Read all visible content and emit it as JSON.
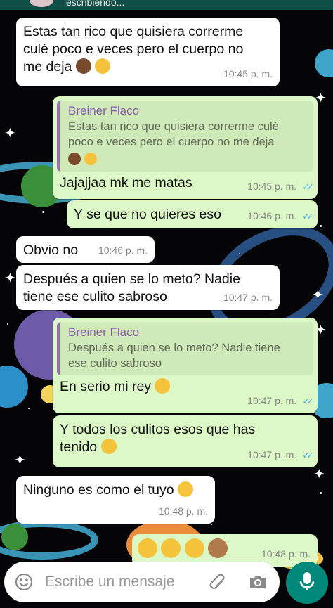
{
  "header": {
    "status": "escribiendo..."
  },
  "messages": [
    {
      "dir": "in",
      "text1": "Estas tan rico que quisiera correrme",
      "text2": "culé poco e veces pero el cuerpo no",
      "text3": "me deja",
      "time": "10:45 p. m."
    },
    {
      "dir": "out",
      "quote_author": "Breiner Flaco",
      "quote_line1": "Estas tan rico que quisiera correrme culé",
      "quote_line2": "poco e veces pero el cuerpo no me deja",
      "text": "Jajajjaa mk me matas",
      "time": "10:45 p. m."
    },
    {
      "dir": "out",
      "text": "Y se que no quieres eso",
      "time": "10:46 p. m."
    },
    {
      "dir": "in",
      "text": "Obvio no",
      "time": "10:46 p. m."
    },
    {
      "dir": "in",
      "text1": "Después a quien se lo meto? Nadie",
      "text2": "tiene ese culito sabroso",
      "time": "10:47 p. m."
    },
    {
      "dir": "out",
      "quote_author": "Breiner Flaco",
      "quote_line1": "Después a quien se lo meto? Nadie tiene",
      "quote_line2": "ese culito sabroso",
      "text": "En serio mi rey",
      "time": "10:47 p. m."
    },
    {
      "dir": "out",
      "text1": "Y todos los culitos esos que has",
      "text2": "tenido",
      "time": "10:47 p. m."
    },
    {
      "dir": "in",
      "text": "Ninguno es como el tuyo",
      "time": "10:48 p. m."
    },
    {
      "dir": "out",
      "time": "10:48 p. m."
    }
  ],
  "composer": {
    "placeholder": "Escribe un mensaje"
  },
  "colors": {
    "incoming": "#ffffff",
    "outgoing": "#dcf8c6",
    "accent": "#00897b",
    "read_ticks": "#4fb6ec"
  },
  "icons": [
    "emoji-icon",
    "attach-icon",
    "camera-icon",
    "mic-icon"
  ]
}
